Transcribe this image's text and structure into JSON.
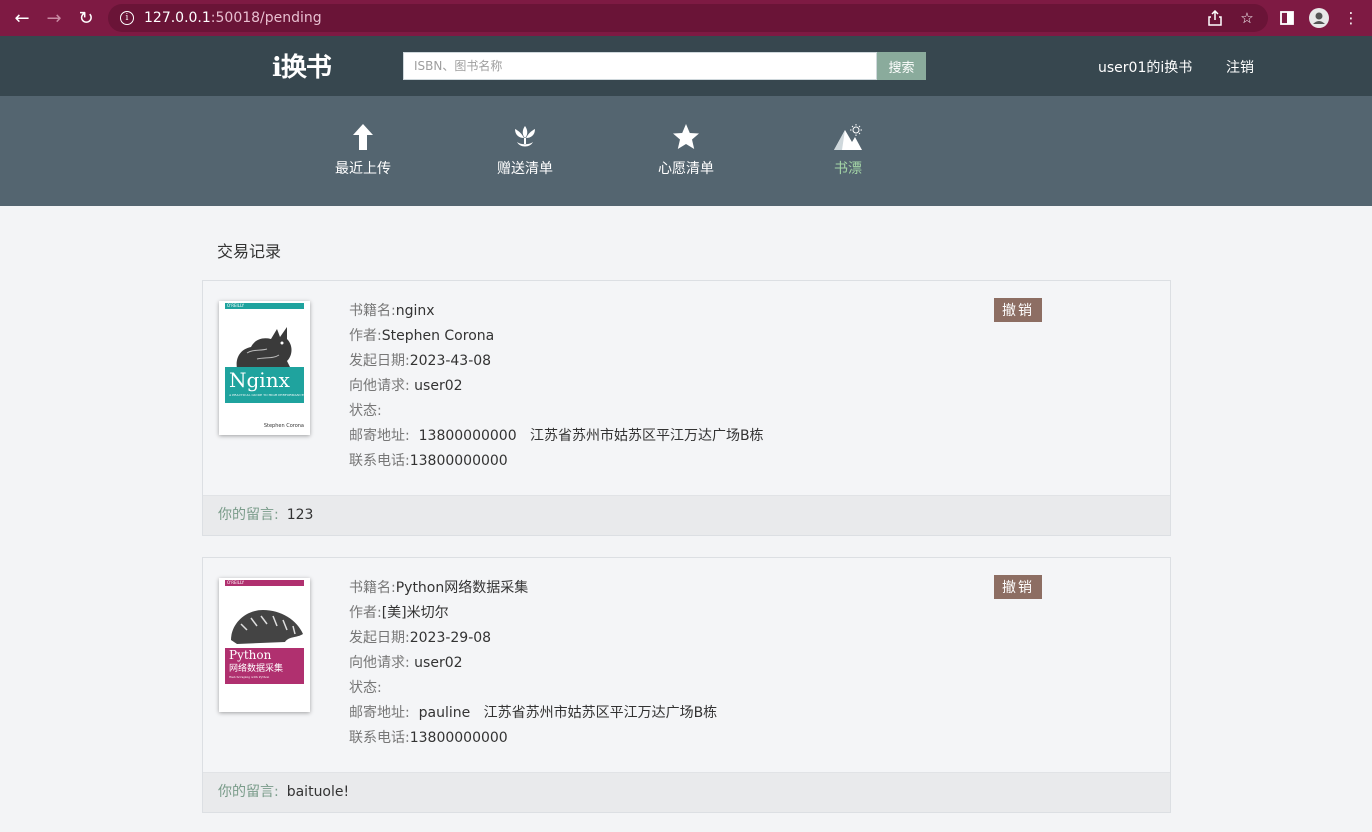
{
  "browser": {
    "url_host": "127.0.0.1",
    "url_port_path": ":50018/pending"
  },
  "header": {
    "logo": "i换书",
    "search_placeholder": "ISBN、图书名称",
    "search_button": "搜索",
    "user_link": "user01的i换书",
    "logout": "注销"
  },
  "nav": [
    {
      "label": "最近上传",
      "icon": "arrow-up-icon",
      "active": false
    },
    {
      "label": "赠送清单",
      "icon": "flower-icon",
      "active": false
    },
    {
      "label": "心愿清单",
      "icon": "star-icon",
      "active": false
    },
    {
      "label": "书漂",
      "icon": "mountain-icon",
      "active": true
    }
  ],
  "section_title": "交易记录",
  "labels": {
    "book_name": "书籍名:",
    "author": "作者:",
    "date": "发起日期:",
    "request_to": "向他请求:",
    "status": "状态:",
    "address": "邮寄地址:",
    "phone": "联系电话:",
    "message": "你的留言:",
    "cancel": "撤销"
  },
  "records": [
    {
      "book_name": "nginx",
      "author": "Stephen Corona",
      "date": "2023-43-08",
      "request_to": "user02",
      "status": "",
      "address": "13800000000   江苏省苏州市姑苏区平江万达广场B栋",
      "phone": "13800000000",
      "message": "123",
      "cover": {
        "publisher": "O'REILLY",
        "title": "Nginx",
        "subtitle": "A PRACTICAL GUIDE TO HIGH PERFORMANCE",
        "author": "Stephen Corona",
        "color": "#1fa39e"
      }
    },
    {
      "book_name": "Python网络数据采集",
      "author": "[美]米切尔",
      "date": "2023-29-08",
      "request_to": "user02",
      "status": "",
      "address": "pauline   江苏省苏州市姑苏区平江万达广场B栋",
      "phone": "13800000000",
      "message": "baituole!",
      "cover": {
        "publisher": "O'REILLY",
        "title": "Python",
        "title2": "网络数据采集",
        "subtitle": "Web Scraping with Python",
        "color": "#b0306f"
      }
    }
  ]
}
